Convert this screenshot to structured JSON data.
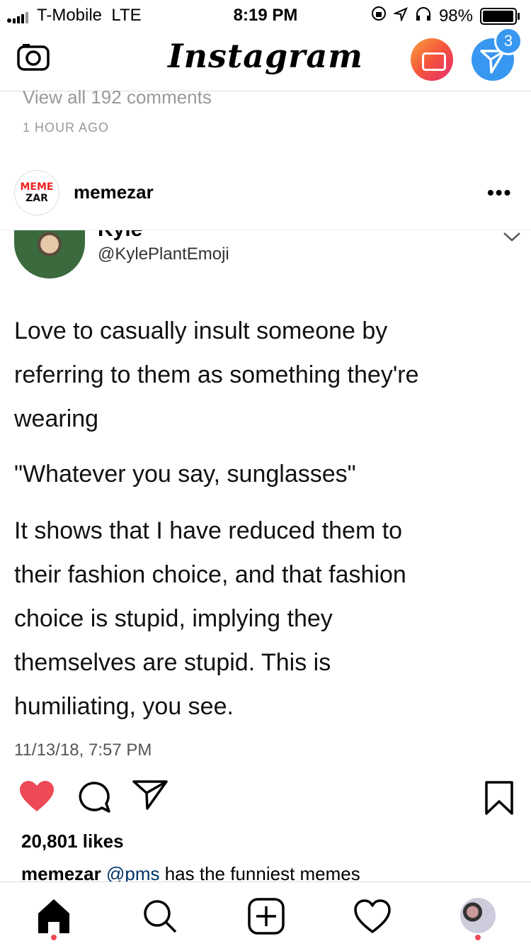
{
  "status_bar": {
    "carrier": "T-Mobile",
    "network": "LTE",
    "time": "8:19 PM",
    "battery_percent": "98%",
    "battery_level": 0.98
  },
  "header": {
    "logo_text": "Instagram",
    "dm_badge_count": "3",
    "igtv_gradient": [
      "#f9a23b",
      "#e52d6e"
    ],
    "dm_color": "#3897f0"
  },
  "comments": {
    "view_all": "View all 192 comments",
    "time_ago": "1 HOUR AGO"
  },
  "post": {
    "username": "memezar",
    "avatar_text_top": "MEME",
    "avatar_text_bottom": "ZAR",
    "more_label": "•••"
  },
  "tweet": {
    "name": "Kyle",
    "handle": "@KylePlantEmoji",
    "lines": [
      "Love to casually insult someone by",
      "referring to them as something they're",
      "wearing",
      "\"Whatever you say, sunglasses\"",
      "It shows that I have reduced them to",
      "their fashion choice, and that fashion",
      "choice is stupid, implying they",
      "themselves are stupid. This is",
      "humiliating, you see."
    ],
    "date": "11/13/18, 7:57 PM"
  },
  "actions": {
    "likes": "20,801 likes",
    "like_color": "#ed4956"
  },
  "caption": {
    "user": "memezar",
    "mention": "@pms",
    "text": "has the funniest memes"
  },
  "nav": {
    "items": [
      "home-icon",
      "search-icon",
      "new-post-icon",
      "activity-icon",
      "profile-avatar"
    ]
  }
}
